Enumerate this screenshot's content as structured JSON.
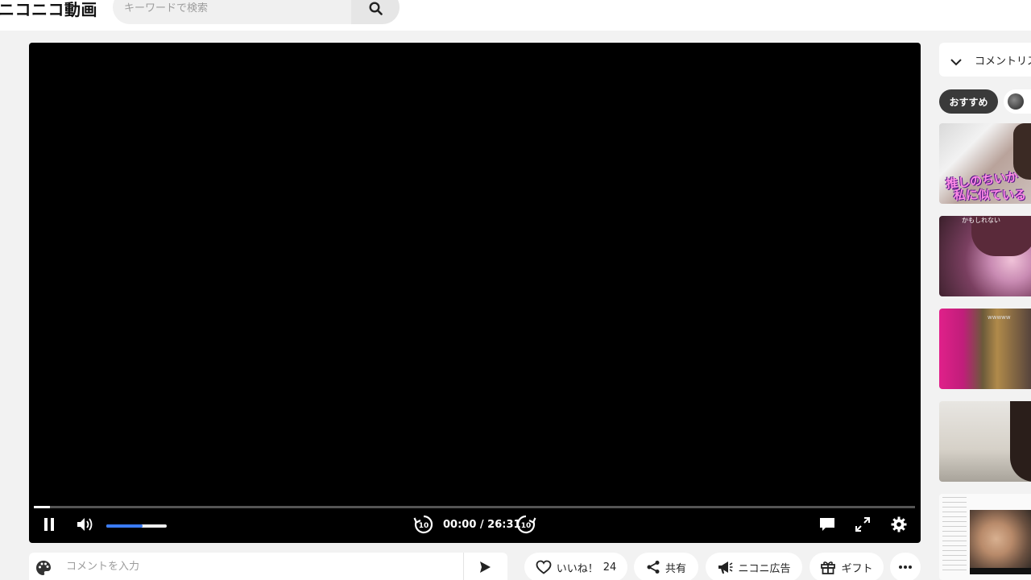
{
  "header": {
    "logo": "ニコニコ動画",
    "search_placeholder": "キーワードで検索"
  },
  "player": {
    "time_current": "00:00",
    "time_total": "26:31",
    "timecode": "00:00 / 26:31",
    "progress_fraction": 0.018,
    "volume_fraction": 0.6,
    "skip_back_label": "10",
    "skip_forward_label": "10"
  },
  "comment_bar": {
    "placeholder": "コメントを入力"
  },
  "actions": {
    "like_label": "いいね！",
    "like_count": "24",
    "share_label": "共有",
    "ad_label": "ニコニ広告",
    "gift_label": "ギフト"
  },
  "right_panel": {
    "header_title": "コメントリス",
    "chip_recommended": "おすすめ",
    "thumbnails": [
      {
        "caption_line1": "推しのちいか",
        "caption_line2": "私に似ている"
      },
      {
        "caption": "かもしれない"
      },
      {
        "caption": "wwwww"
      },
      {
        "caption": ""
      },
      {
        "caption": ""
      }
    ]
  },
  "colors": {
    "accent_blue": "#3a7bf5",
    "player_bg": "#000000",
    "page_bg": "#f2f2f2"
  }
}
